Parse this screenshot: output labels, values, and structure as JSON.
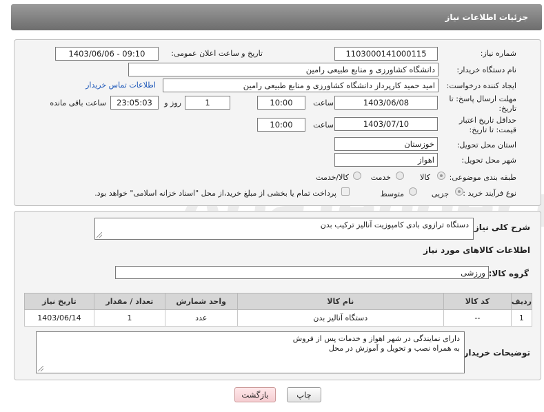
{
  "header": {
    "title": "جزئیات اطلاعات نیاز"
  },
  "watermark": "AriaTender.net",
  "form": {
    "need_number_label": "شماره نیاز:",
    "need_number_value": "1103000141000115",
    "announce_label": "تاریخ و ساعت اعلان عمومی:",
    "announce_value": "1403/06/06 - 09:10",
    "buyer_org_label": "نام دستگاه خریدار:",
    "buyer_org_value": "دانشگاه کشاورزی و منابع طبیعی رامین",
    "creator_label": "ایجاد کننده درخواست:",
    "creator_value": "امید حمید کارپرداز دانشگاه کشاورزی و منابع طبیعی رامین",
    "contact_link": "اطلاعات تماس خریدار",
    "deadline_label": "مهلت ارسال پاسخ: تا تاریخ:",
    "deadline_date": "1403/06/08",
    "deadline_time_label": "ساعت",
    "deadline_time": "10:00",
    "days_value": "1",
    "days_label": "روز و",
    "remaining_time": "23:05:03",
    "remaining_label": "ساعت باقی مانده",
    "validity_label": "حداقل تاریخ اعتبار قیمت: تا تاریخ:",
    "validity_date": "1403/07/10",
    "validity_time_label": "ساعت",
    "validity_time": "10:00",
    "province_label": "استان محل تحویل:",
    "province_value": "خوزستان",
    "city_label": "شهر محل تحویل:",
    "city_value": "اهواز",
    "category_label": "طبقه بندی موضوعی:",
    "category_options": [
      "کالا",
      "خدمت",
      "کالا/خدمت"
    ],
    "process_label": "نوع فرآیند خرید :",
    "process_options": [
      "جزیی",
      "متوسط"
    ],
    "payment_text": "پرداخت تمام یا بخشی از مبلغ خرید،از محل \"اسناد خزانه اسلامی\" خواهد بود."
  },
  "details": {
    "summary_label": "شرح کلی نیاز:",
    "summary_value": "دستگاه ترازوی بادی کامپوزیت آنالیز ترکیب بدن",
    "goods_info_title": "اطلاعات کالاهای مورد نیاز",
    "goods_group_label": "گروه کالا:",
    "goods_group_value": "ورزشی",
    "table": {
      "headers": [
        "ردیف",
        "کد کالا",
        "نام کالا",
        "واحد شمارش",
        "تعداد / مقدار",
        "تاریخ نیاز"
      ],
      "rows": [
        [
          "1",
          "--",
          "دستگاه آنالیز بدن",
          "عدد",
          "1",
          "1403/06/14"
        ]
      ]
    },
    "buyer_notes_label": "توضیحات خریدار:",
    "buyer_notes_line1": "دارای نمایندگی در شهر اهواز و خدمات پس از فروش",
    "buyer_notes_line2": "به همراه نصب و تحویل و آموزش در محل"
  },
  "buttons": {
    "print": "چاپ",
    "back": "بازگشت"
  }
}
